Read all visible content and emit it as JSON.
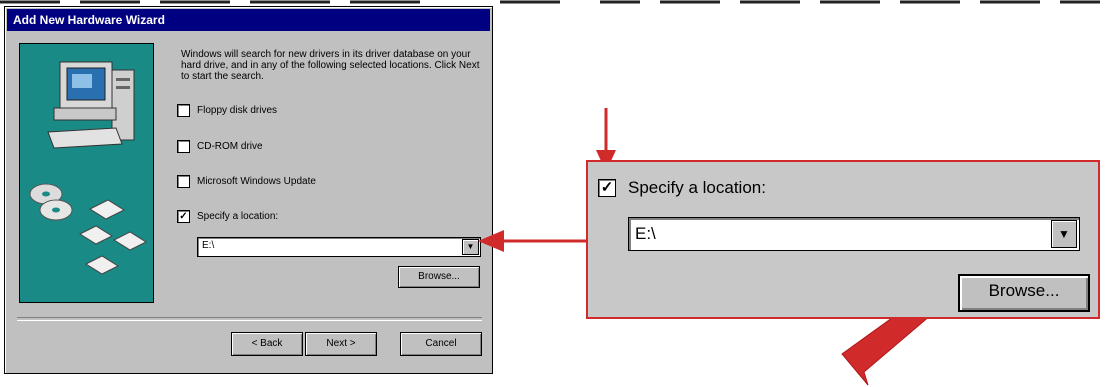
{
  "dialog": {
    "title": "Add New Hardware Wizard",
    "intro": "Windows will search for new drivers in its driver database on your hard drive, and in any of the following selected locations. Click Next to start the search.",
    "options": [
      {
        "label": "Floppy disk drives",
        "checked": false
      },
      {
        "label": "CD-ROM drive",
        "checked": false
      },
      {
        "label": "Microsoft Windows Update",
        "checked": false
      },
      {
        "label": "Specify a location:",
        "checked": true
      }
    ],
    "location_value": "E:\\",
    "browse_label": "Browse...",
    "back_label": "< Back",
    "next_label": "Next >",
    "cancel_label": "Cancel"
  },
  "zoom": {
    "checkbox_label": "Specify a location:",
    "checked": true,
    "location_value": "E:\\",
    "browse_label": "Browse..."
  },
  "colors": {
    "titlebar": "#000080",
    "dialog_bg": "#c0c0c0",
    "illustration_bg": "#1a8a86",
    "highlight_red": "#d12a2a"
  },
  "icons": [
    "computer-icon",
    "cd-disc-icon",
    "floppy-disk-icon",
    "dropdown-arrow-icon",
    "checkmark-icon",
    "pointer-arrow-icon"
  ]
}
